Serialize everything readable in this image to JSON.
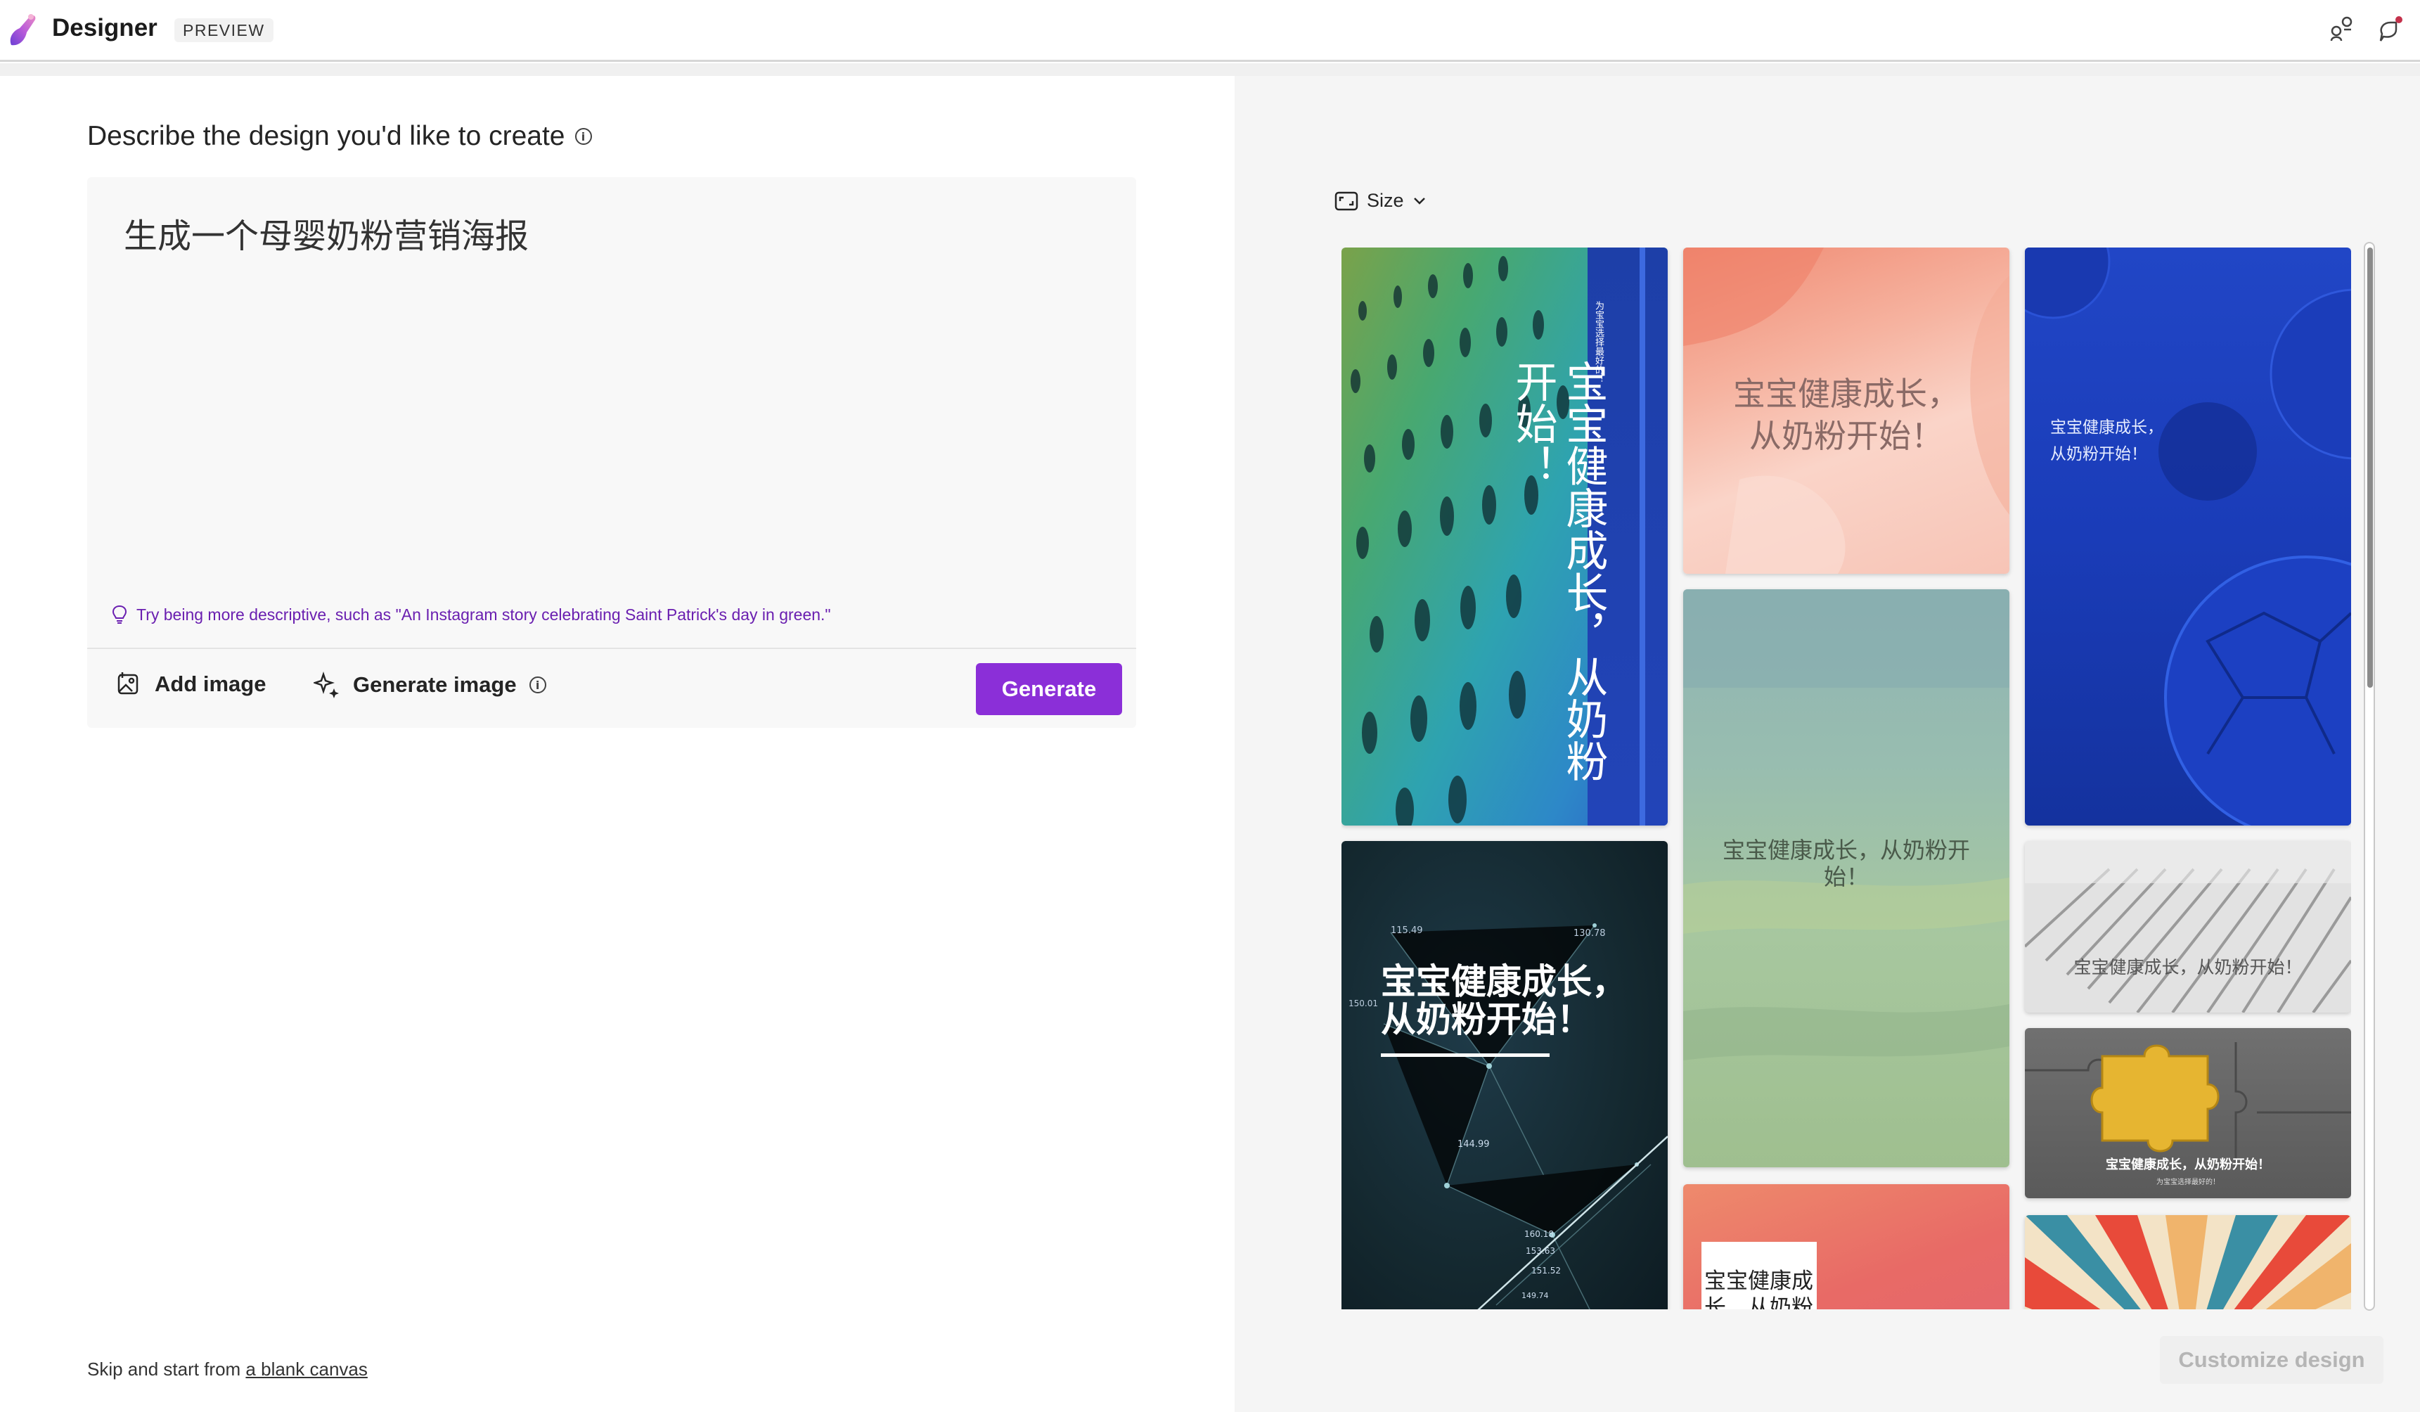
{
  "header": {
    "app_name": "Designer",
    "badge": "PREVIEW",
    "icons": [
      "share-icon",
      "feedback-icon"
    ]
  },
  "left": {
    "heading": "Describe the design you'd like to create",
    "prompt": "生成一个母婴奶粉营销海报",
    "tip": "Try being more descriptive, such as \"An Instagram story celebrating Saint Patrick's day in green.\"",
    "add_image": "Add image",
    "generate_image": "Generate image",
    "generate_button": "Generate",
    "skip_prefix": "Skip and start from ",
    "skip_link": "a blank canvas"
  },
  "right": {
    "size_label": "Size",
    "customize_button": "Customize design"
  },
  "gallery": {
    "tile1": {
      "title": "宝宝健康成长，从奶粉开始！",
      "small": "为宝宝选择最好的！"
    },
    "tile2": {
      "line1": "宝宝健康成长，",
      "line2": "从奶粉开始！"
    },
    "tile3": {
      "line1": "宝宝健康成长，",
      "line2": "从奶粉开始！"
    },
    "tile4": {
      "line1": "宝宝健康成长，从奶粉开",
      "line2": "始！"
    },
    "tile5": {
      "text": "宝宝健康成长，从奶粉开始！"
    },
    "tile6": {
      "line1": "宝宝健康成长，",
      "line2": "从奶粉开始！",
      "numbers": [
        "115.49",
        "130.78",
        "150.01",
        "144.99",
        "160.18",
        "153.63",
        "151.52",
        "149.74"
      ]
    },
    "tile7": {
      "text": "宝宝健康成长，从奶粉开始！",
      "small": "为宝宝选择最好的！"
    },
    "tile8": {
      "line1": "宝宝健康成",
      "line2": "长，从奶粉"
    },
    "colors": {
      "accent": "#8b2fd8",
      "tip": "#6a1fb0"
    }
  }
}
